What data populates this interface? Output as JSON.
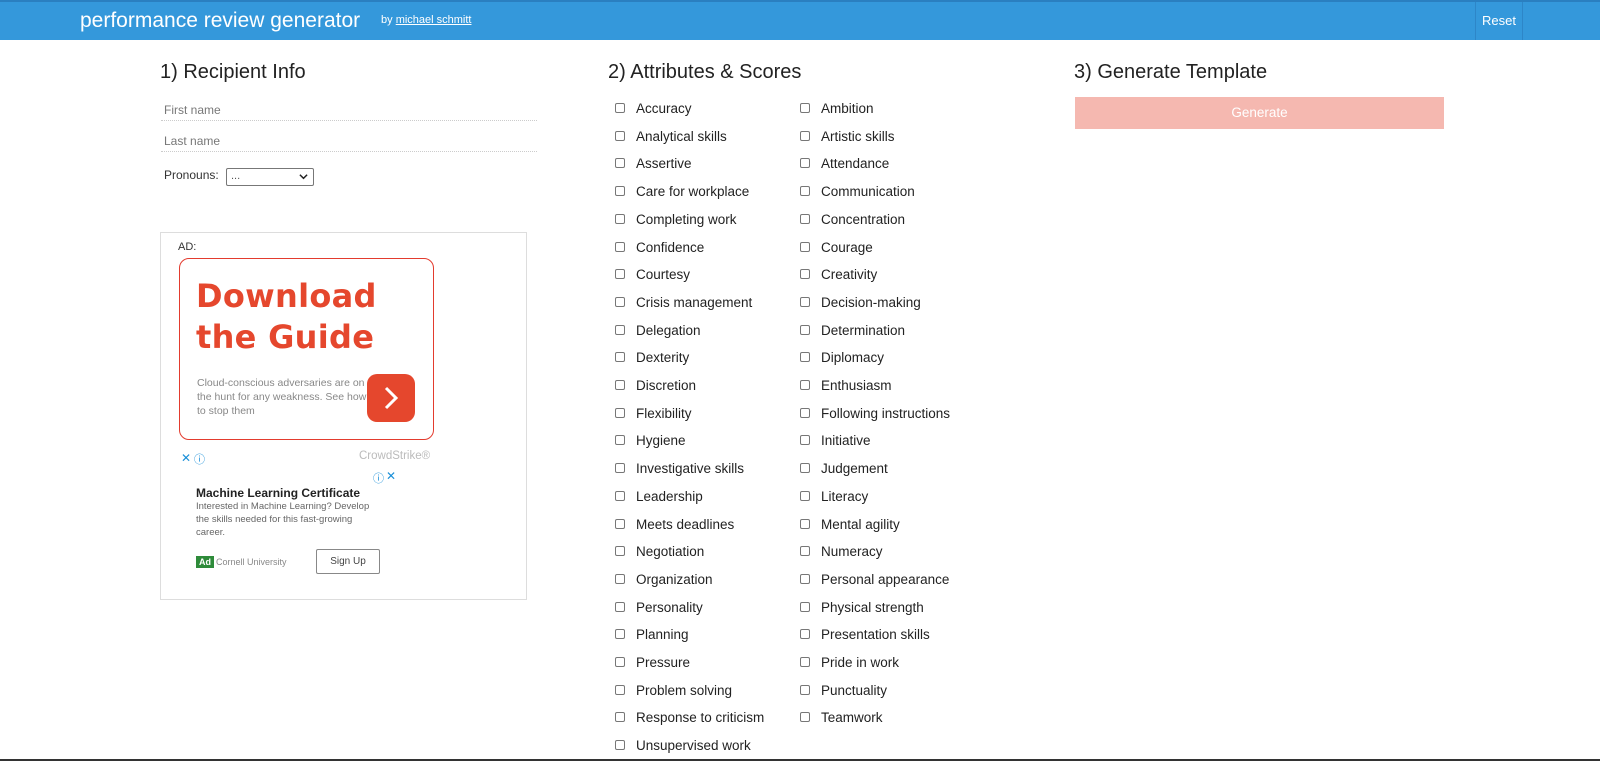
{
  "header": {
    "title": "performance review generator",
    "by_prefix": "by",
    "author": "michael schmitt",
    "reset_label": "Reset",
    "color": "#3498db"
  },
  "recipient": {
    "heading": "1) Recipient Info",
    "first_name_placeholder": "First name",
    "last_name_placeholder": "Last name",
    "pronouns_label": "Pronouns:",
    "pronouns_value": "..."
  },
  "ad": {
    "label": "AD:",
    "headline": "Download\nthe Guide",
    "body": "Cloud-conscious adversaries are on the hunt for any weakness. See how to stop them",
    "brand": "CrowdStrike®",
    "accent": "#e5472d",
    "second": {
      "title": "Machine Learning Certificate",
      "body": "Interested in Machine Learning? Develop the skills needed for this fast-growing career.",
      "tag": "Ad",
      "sponsor": "Cornell University",
      "button": "Sign Up"
    }
  },
  "attributes": {
    "heading": "2) Attributes & Scores",
    "column1": [
      "Accuracy",
      "Analytical skills",
      "Assertive",
      "Care for workplace",
      "Completing work",
      "Confidence",
      "Courtesy",
      "Crisis management",
      "Delegation",
      "Dexterity",
      "Discretion",
      "Flexibility",
      "Hygiene",
      "Investigative skills",
      "Leadership",
      "Meets deadlines",
      "Negotiation",
      "Organization",
      "Personality",
      "Planning",
      "Pressure",
      "Problem solving",
      "Response to criticism",
      "Unsupervised work"
    ],
    "column2": [
      "Ambition",
      "Artistic skills",
      "Attendance",
      "Communication",
      "Concentration",
      "Courage",
      "Creativity",
      "Decision-making",
      "Determination",
      "Diplomacy",
      "Enthusiasm",
      "Following instructions",
      "Initiative",
      "Judgement",
      "Literacy",
      "Mental agility",
      "Numeracy",
      "Personal appearance",
      "Physical strength",
      "Presentation skills",
      "Pride in work",
      "Punctuality",
      "Teamwork"
    ]
  },
  "generate": {
    "heading": "3) Generate Template",
    "button_label": "Generate",
    "button_color": "#f5b8b0"
  }
}
